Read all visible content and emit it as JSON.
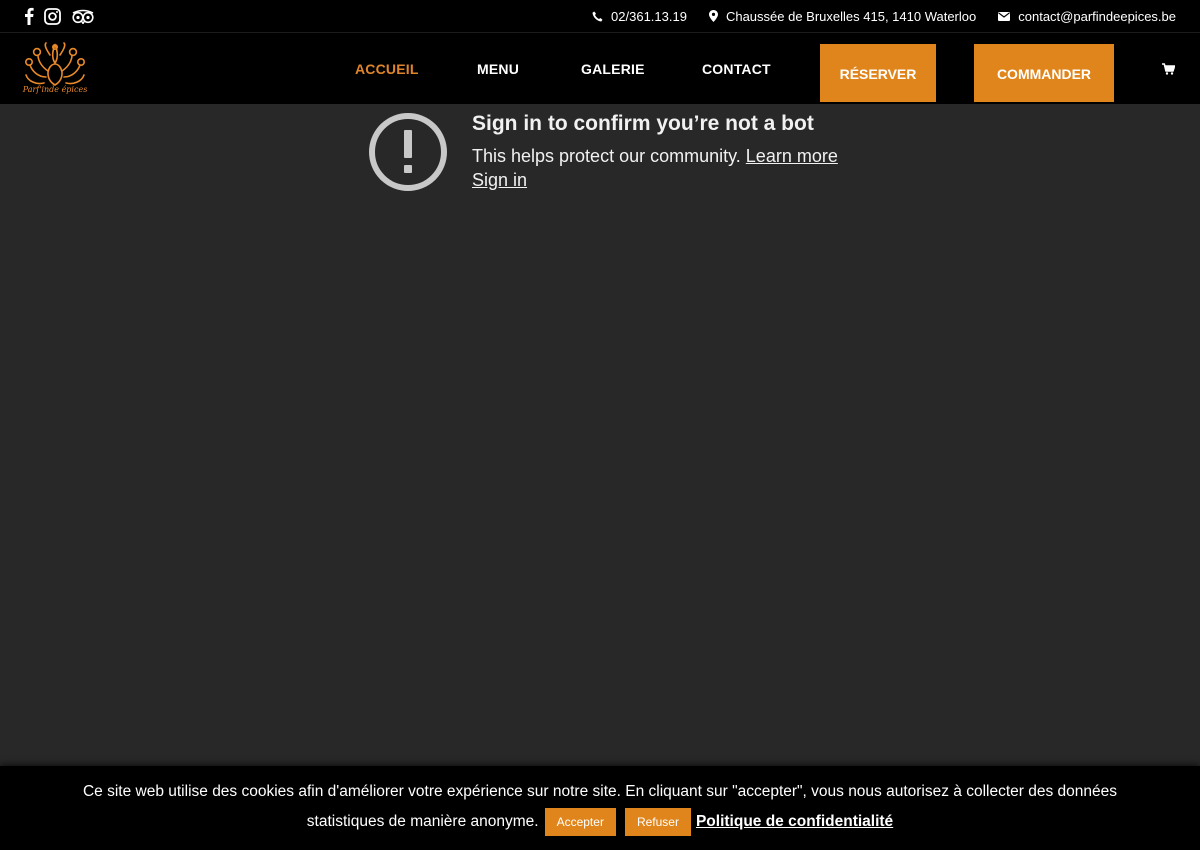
{
  "topbar": {
    "social_icons": [
      "facebook-icon",
      "instagram-icon",
      "tripadvisor-icon"
    ],
    "phone": "02/361.13.19",
    "address": "Chaussée de Bruxelles 415, 1410 Waterloo",
    "email": "contact@parfindeepices.be"
  },
  "header": {
    "logo_text": "Parf'inde épices",
    "nav": [
      {
        "label": "ACCUEIL",
        "active": true
      },
      {
        "label": "MENU",
        "active": false
      },
      {
        "label": "GALERIE",
        "active": false
      },
      {
        "label": "CONTACT",
        "active": false
      }
    ],
    "reserve_label": "RÉSERVER",
    "order_label": "COMMANDER",
    "cart_icon": "cart-icon"
  },
  "botcheck": {
    "title": "Sign in to confirm you’re not a bot",
    "text": "This helps protect our community.",
    "learn_more": "Learn more",
    "sign_in": "Sign in"
  },
  "cookie": {
    "line1": "Ce site web utilise des cookies afin d'améliorer votre expérience sur notre site. En cliquant sur \"accepter\", vous nous autorisez à collecter des données",
    "line2": "statistiques de manière anonyme.",
    "accept_label": "Accepter",
    "refuse_label": "Refuser",
    "policy_label": "Politique de confidentialité"
  },
  "colors": {
    "accent": "#e0851b",
    "background": "#282828",
    "bar": "#000000"
  }
}
